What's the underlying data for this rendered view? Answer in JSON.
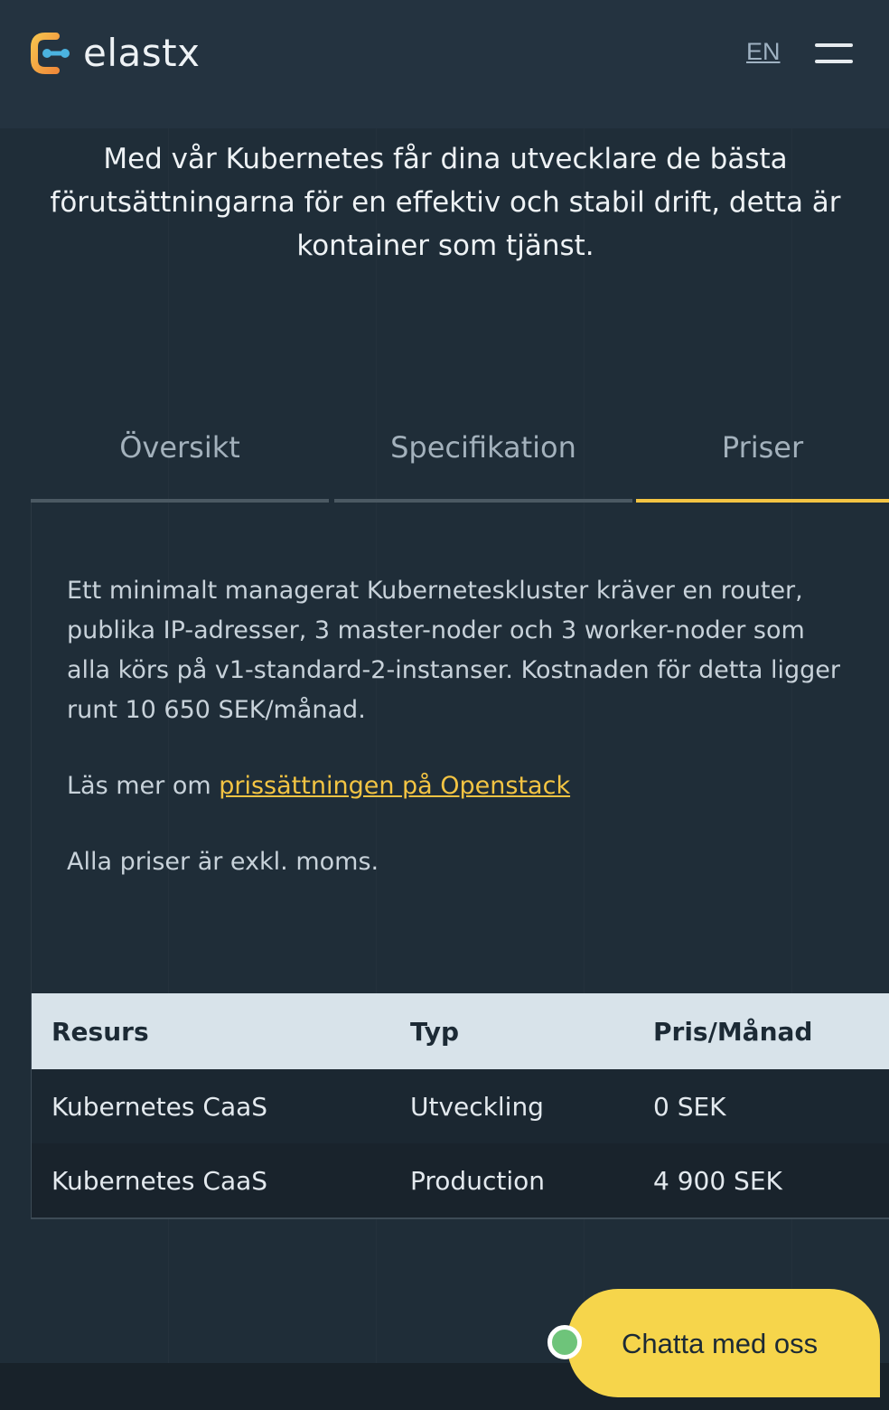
{
  "header": {
    "brand": "elastx",
    "lang": "EN",
    "colors": {
      "logo_orange": "#f0a53a",
      "logo_blue": "#4bb3e0"
    }
  },
  "intro": {
    "text": "Med vår Kubernetes får dina utvecklare de bästa förutsättningarna för en effektiv och stabil drift, detta är kontainer som tjänst."
  },
  "tabs": [
    {
      "label": "Översikt",
      "active": false
    },
    {
      "label": "Specifikation",
      "active": false
    },
    {
      "label": "Priser",
      "active": true
    }
  ],
  "panel": {
    "p1": "Ett minimalt managerat Kuberneteskluster kräver en router, publika IP-adresser, 3 master-noder och 3 worker-noder som alla körs på v1-standard-2-instanser. Kostnaden för detta ligger runt 10 650 SEK/månad.",
    "p2_prefix": "Läs mer om ",
    "p2_link": "prissättningen på Openstack",
    "p3": "Alla priser är exkl. moms."
  },
  "table": {
    "headers": [
      "Resurs",
      "Typ",
      "Pris/Månad"
    ],
    "rows": [
      [
        "Kubernetes CaaS",
        "Utveckling",
        "0 SEK"
      ],
      [
        "Kubernetes CaaS",
        "Production",
        "4 900 SEK"
      ]
    ]
  },
  "chat": {
    "label": "Chatta med oss",
    "status_color": "#6ec47a",
    "button_color": "#f6d54b"
  },
  "accent": "#f3c443"
}
